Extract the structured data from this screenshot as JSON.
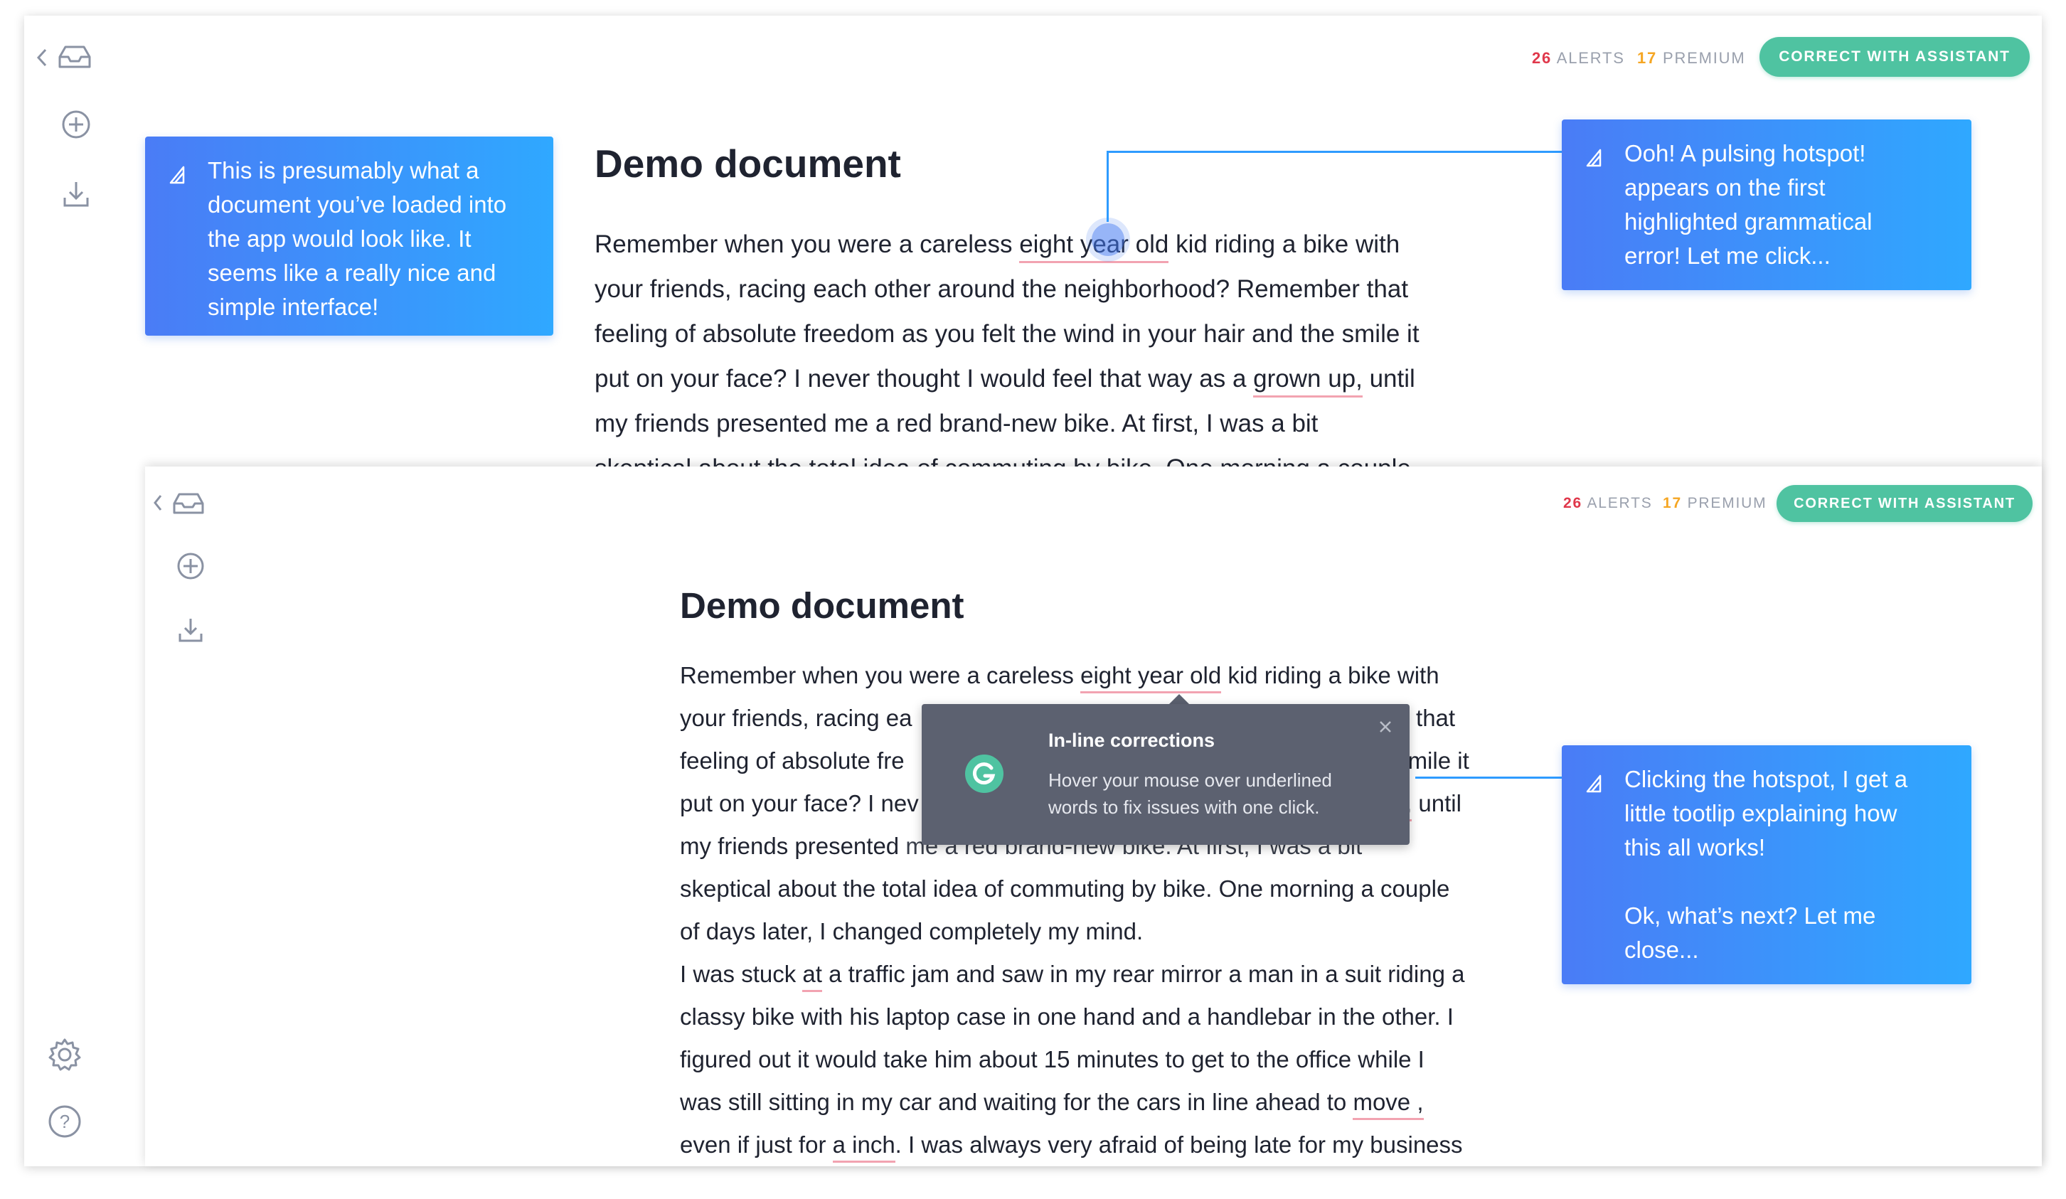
{
  "toolbar": {
    "alerts_count": "26",
    "alerts_label": "ALERTS",
    "premium_count": "17",
    "premium_label": "PREMIUM",
    "assistant_button": "CORRECT WITH ASSISTANT"
  },
  "document": {
    "title": "Demo document",
    "top_lines": [
      [
        "Remember when you were a careless ",
        "eight year old",
        " kid riding a bike with"
      ],
      [
        "your friends, racing each other around the neighborhood? Remember that"
      ],
      [
        "feeling of absolute freedom as you felt the wind in your hair and the smile it"
      ],
      [
        "put on your face? I never thought I would feel that way as a ",
        "grown up,",
        " until"
      ],
      [
        "my friends presented me a red brand-new bike. At first, I was a bit"
      ],
      [
        "skeptical about the total idea of commuting by bike. One morning a couple"
      ]
    ],
    "bottom_lines": {
      "l1": [
        "Remember when you were a careless ",
        "eight year old",
        " kid riding a bike with"
      ],
      "l2a": "your friends, racing ea",
      "l2b": "er that",
      "l3a": "feeling of absolute fre",
      "l3b": "e smile it",
      "l4a": "put on your face? I nev",
      "l4u": "p,",
      "l4b": " until",
      "l5a": "my friends presented ",
      "l5b": "me a red brand-new bike. At first, I was a bit",
      "l6": "skeptical about the total idea of commuting by bike. One morning a couple",
      "l7": "of days later, I changed completely my mind.",
      "l8": [
        "I was stuck ",
        "at",
        " a traffic jam and saw in my rear mirror a man in a suit riding a"
      ],
      "l9": "classy bike with his laptop case in one hand and a handlebar in the other. I",
      "l10": "figured out it would take him about 15 minutes to get to the office while I",
      "l11": [
        "was still sitting in my car and waiting for the cars in line ahead to ",
        "move ,"
      ],
      "l12": [
        "even if just for ",
        "a inch",
        ". I was always very afraid of being late for my business"
      ]
    }
  },
  "callouts": {
    "left": "This is presumably what a\ndocument you’ve loaded into\nthe app would look like.  It\nseems like a really nice and\nsimple interface!",
    "right_top": "Ooh!  A pulsing hotspot!\nappears on the first\nhighlighted grammatical\nerror!  Let me click...",
    "right_bottom": "Clicking the hotspot, I get a\nlittle tootlip explaining how\nthis all works!\n\nOk, what’s next?  Let me\nclose..."
  },
  "tooltip": {
    "title": "In-line corrections",
    "body_line1": "Hover your mouse over underlined",
    "body_line2": "words to fix issues with one click."
  },
  "icons": [
    "chevron-left-icon",
    "inbox-icon",
    "plus-circle-icon",
    "download-icon",
    "gear-icon",
    "help-icon",
    "close-icon",
    "grammarly-logo-icon",
    "callout-logo-icon"
  ],
  "colors": {
    "accent_green": "#4fc3a1",
    "alerts_red": "#e0384b",
    "premium_orange": "#f5a623",
    "underline_pink": "#f2a3b1",
    "callout_blue_start": "#4a7cf6",
    "callout_blue_end": "#2fa8ff",
    "tooltip_bg": "#5c6170"
  }
}
